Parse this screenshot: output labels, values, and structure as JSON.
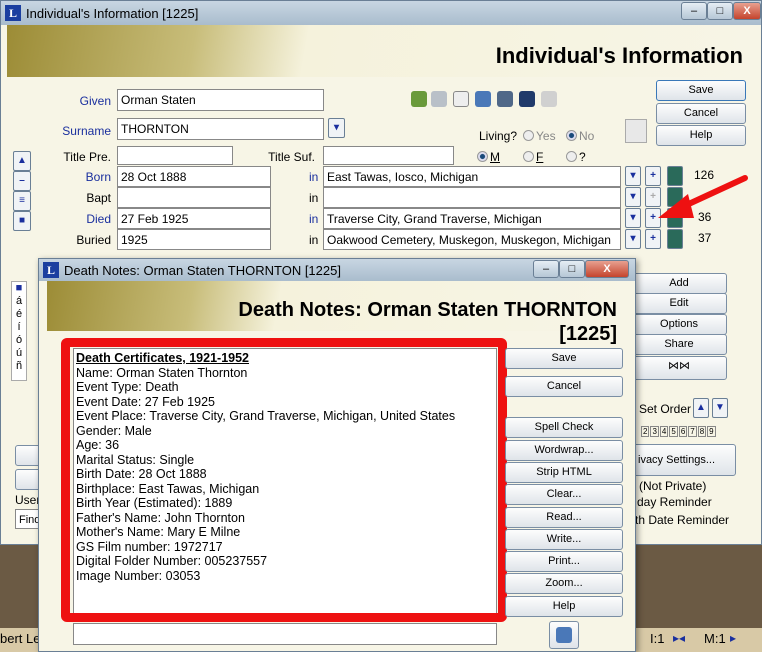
{
  "main_window": {
    "title": "Individual's Information  [1225]",
    "header_title": "Individual's Information",
    "buttons": {
      "save": "Save",
      "cancel": "Cancel",
      "help": "Help"
    },
    "fields": {
      "given_label": "Given",
      "given": "Orman Staten",
      "surname_label": "Surname",
      "surname": "THORNTON",
      "title_pre_label": "Title Pre.",
      "title_pre": "",
      "title_suf_label": "Title Suf.",
      "title_suf": ""
    },
    "living": {
      "label": "Living?",
      "yes": "Yes",
      "no": "No",
      "selected": "No"
    },
    "sex": {
      "m": "M",
      "f": "F",
      "unknown": "?",
      "selected": "M"
    },
    "in_label": "in",
    "events": [
      {
        "label": "Born",
        "date": "28 Oct 1888",
        "place": "East Tawas, Iosco, Michigan",
        "count": "126"
      },
      {
        "label": "Bapt",
        "date": "",
        "place": "",
        "count": ""
      },
      {
        "label": "Died",
        "date": "27 Feb 1925",
        "place": "Traverse City, Grand Traverse, Michigan",
        "count": "36"
      },
      {
        "label": "Buried",
        "date": "1925",
        "place": "Oakwood Cemetery, Muskegon, Muskegon, Michigan",
        "count": "37"
      }
    ],
    "right_panel": {
      "add": "Add",
      "edit": "Edit",
      "options": "Options",
      "share": "Share",
      "set_order": "Set Order",
      "numbers": [
        "2",
        "3",
        "4",
        "5",
        "6",
        "7",
        "8",
        "9"
      ],
      "privacy": "ivacy Settings...",
      "not_private": "(Not Private)",
      "birthday_reminder": "day Reminder",
      "death_reminder": "th Date Reminder"
    },
    "left": {
      "accents": [
        "á",
        "é",
        "í",
        "ó",
        "ú",
        "ñ"
      ],
      "user_label": "User I",
      "user_value": "FindA"
    },
    "status": {
      "name": "bert Lee",
      "i": "I:1",
      "m": "M:1"
    }
  },
  "dialog": {
    "title": "Death Notes: Orman Staten THORNTON [1225]",
    "header_line1": "Death Notes: Orman Staten THORNTON",
    "header_line2": "[1225]",
    "notes_heading": "Death Certificates, 1921-1952",
    "notes_lines": [
      "Name: Orman Staten Thornton",
      "Event Type: Death",
      "Event Date: 27 Feb 1925",
      "Event Place: Traverse City, Grand Traverse, Michigan, United States",
      "Gender: Male",
      "Age: 36",
      "Marital Status: Single",
      "Birth Date: 28 Oct 1888",
      "Birthplace: East Tawas, Michigan",
      "Birth Year (Estimated): 1889",
      "Father's Name: John Thornton",
      "Mother's Name: Mary E Milne",
      "GS Film number: 1972717",
      "Digital Folder Number: 005237557",
      "Image Number: 03053"
    ],
    "buttons": {
      "save": "Save",
      "cancel": "Cancel",
      "spell": "Spell Check",
      "wordwrap": "Wordwrap...",
      "strip": "Strip HTML",
      "clear": "Clear...",
      "read": "Read...",
      "write": "Write...",
      "print": "Print...",
      "zoom": "Zoom...",
      "help": "Help"
    }
  },
  "colors": {
    "highlight": "#ee1111",
    "label_blue": "#1a2f9e"
  }
}
